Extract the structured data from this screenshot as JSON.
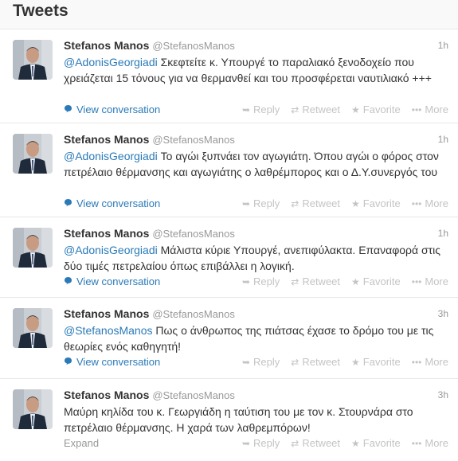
{
  "header": {
    "title": "Tweets"
  },
  "actions": {
    "reply": "Reply",
    "retweet": "Retweet",
    "favorite": "Favorite",
    "more": "More"
  },
  "tweets": [
    {
      "name": "Stefanos Manos",
      "handle": "@StefanosManos",
      "time": "1h",
      "mention": "@AdonisGeorgiadi",
      "text": " Σκεφτείτε κ. Υπουργέ το παραλιακό ξενοδοχείο που χρειάζεται 15 τόνους για να θερμανθεί και του προσφέρεται ναυτιλιακό +++",
      "footer": "View conversation"
    },
    {
      "name": "Stefanos Manos",
      "handle": "@StefanosManos",
      "time": "1h",
      "mention": "@AdonisGeorgiadi",
      "text": " Το αγώι ξυπνάει τον αγωγιάτη. Όπου αγώι ο φόρος στον πετρέλαιο θέρμανσης και αγωγιάτης ο λαθρέμπορος και ο Δ.Υ.συνεργός του",
      "footer": "View conversation"
    },
    {
      "name": "Stefanos Manos",
      "handle": "@StefanosManos",
      "time": "1h",
      "mention": "@AdonisGeorgiadi",
      "text": " Μάλιστα κύριε Υπουργέ, ανεπιφύλακτα. Επαναφορά στις δύο τιμές πετρελαίου όπως επιβάλλει η λογική.",
      "footer": "View conversation"
    },
    {
      "name": "Stefanos Manos",
      "handle": "@StefanosManos",
      "time": "3h",
      "mention": "@StefanosManos",
      "text": " Πως ο άνθρωπος της πιάτσας έχασε το δρόμο του με τις θεωρίες ενός καθηγητή!",
      "footer": "View conversation"
    },
    {
      "name": "Stefanos Manos",
      "handle": "@StefanosManos",
      "time": "3h",
      "mention": "",
      "text": "Μαύρη κηλίδα του κ. Γεωργιάδη η ταύτιση του με τον κ. Στουρνάρα στο πετρέλαιο θέρμανσης. Η χαρά των λαθρεμπόρων!",
      "footer": "Expand"
    }
  ],
  "colors": {
    "link": "#2a7ab8",
    "muted": "#999999",
    "action": "#c4c4c4"
  }
}
